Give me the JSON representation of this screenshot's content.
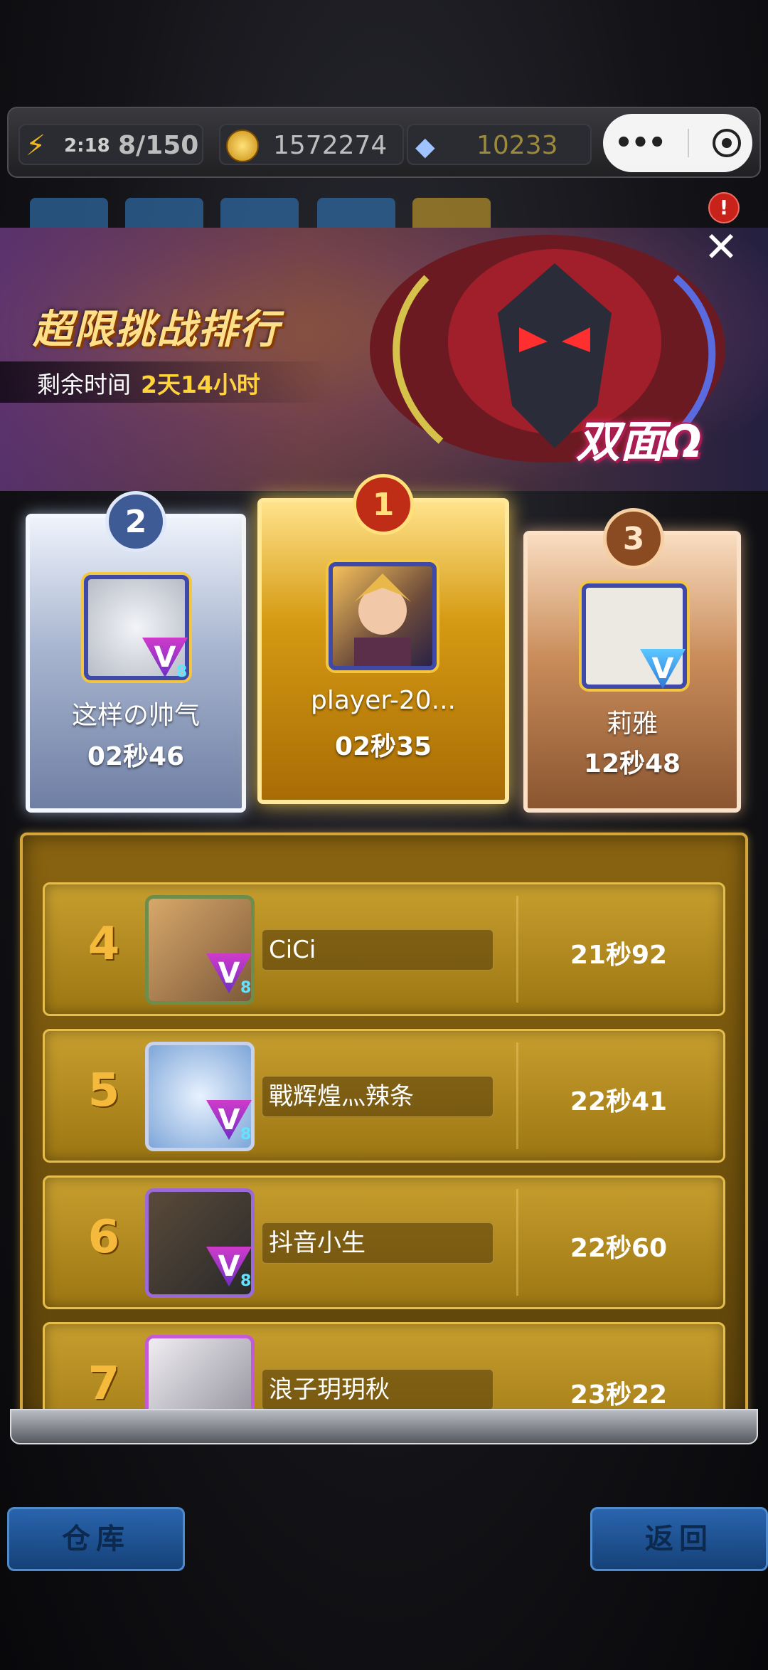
{
  "topbar": {
    "energy_timer": "2:18",
    "energy": "8/150",
    "gold": "1572274",
    "diamonds": "10233"
  },
  "banner": {
    "title": "超限挑战排行",
    "remaining_label": "剩余时间",
    "remaining_value": "2天14小时",
    "boss_name": "双面Ω",
    "alert_badge": "!"
  },
  "podium": [
    {
      "rank": "2",
      "name": "这样の帅气",
      "time": "02秒46",
      "level": "8"
    },
    {
      "rank": "1",
      "name": "player-20...",
      "time": "02秒35"
    },
    {
      "rank": "3",
      "name": "莉雅",
      "time": "12秒48"
    }
  ],
  "list": [
    {
      "rank": "4",
      "name": "CiCi",
      "time": "21秒92",
      "level": "8"
    },
    {
      "rank": "5",
      "name": "戰辉煌灬辣条",
      "time": "22秒41",
      "level": "8"
    },
    {
      "rank": "6",
      "name": "抖音小生",
      "time": "22秒60",
      "level": "8"
    },
    {
      "rank": "7",
      "name": "浪子玥玥秋",
      "time": "23秒22"
    }
  ],
  "bottom": {
    "left_button": "仓库",
    "right_button": "返回"
  },
  "icons": {
    "close": "close-icon",
    "more": "more-dots-icon",
    "target": "target-icon",
    "lightning": "lightning-icon",
    "coin": "coin-icon",
    "diamond": "diamond-icon"
  },
  "colors": {
    "gold_accent": "#ffd43a",
    "card_gold": "#d59a12",
    "card_silver": "#a8b5d0",
    "card_bronze": "#c98c5a",
    "list_row": "#c79e2e"
  }
}
